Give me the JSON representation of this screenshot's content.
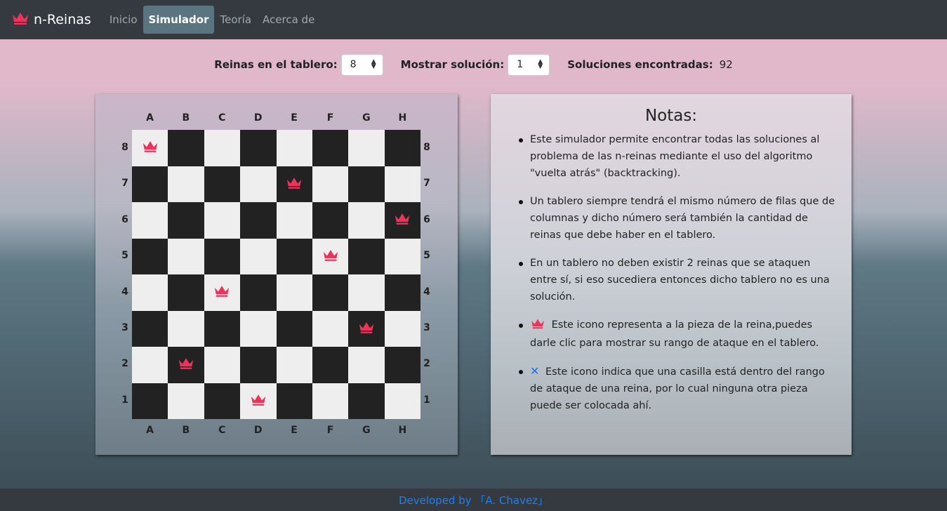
{
  "navbar": {
    "brand": "n-Reinas",
    "items": [
      {
        "label": "Inicio",
        "active": false
      },
      {
        "label": "Simulador",
        "active": true
      },
      {
        "label": "Teoría",
        "active": false
      },
      {
        "label": "Acerca de",
        "active": false
      }
    ]
  },
  "controls": {
    "queens_label": "Reinas en el tablero:",
    "queens_value": "8",
    "solution_label": "Mostrar solución:",
    "solution_value": "1",
    "found_label": "Soluciones encontradas:",
    "found_value": "92"
  },
  "board": {
    "columns": [
      "A",
      "B",
      "C",
      "D",
      "E",
      "F",
      "G",
      "H"
    ],
    "rows": [
      "8",
      "7",
      "6",
      "5",
      "4",
      "3",
      "2",
      "1"
    ],
    "queens": [
      {
        "row": "8",
        "col": "A"
      },
      {
        "row": "7",
        "col": "E"
      },
      {
        "row": "6",
        "col": "H"
      },
      {
        "row": "5",
        "col": "F"
      },
      {
        "row": "4",
        "col": "C"
      },
      {
        "row": "3",
        "col": "G"
      },
      {
        "row": "2",
        "col": "B"
      },
      {
        "row": "1",
        "col": "D"
      }
    ],
    "queen_color": "#f0325a"
  },
  "notes": {
    "title": "Notas:",
    "items": [
      "Este simulador permite encontrar todas las soluciones al problema de las n-reinas mediante el uso del algoritmo \"vuelta atrás\" (backtracking).",
      "Un tablero siempre tendrá el mismo número de filas que de columnas y dicho número será también la cantidad de reinas que debe haber en el tablero.",
      "En un tablero no deben existir 2 reinas que se ataquen entre sí, si eso sucediera entonces dicho tablero no es una solución.",
      "Este icono representa a la pieza de la reina,puedes darle clic para mostrar su rango de ataque en el tablero.",
      "Este icono indica que una casilla está dentro del rango de ataque de una reina, por lo cual ninguna otra pieza puede ser colocada ahí."
    ],
    "x_icon_color": "#1a73e8"
  },
  "footer": {
    "text": "Developed by 「A. Chavez」"
  }
}
